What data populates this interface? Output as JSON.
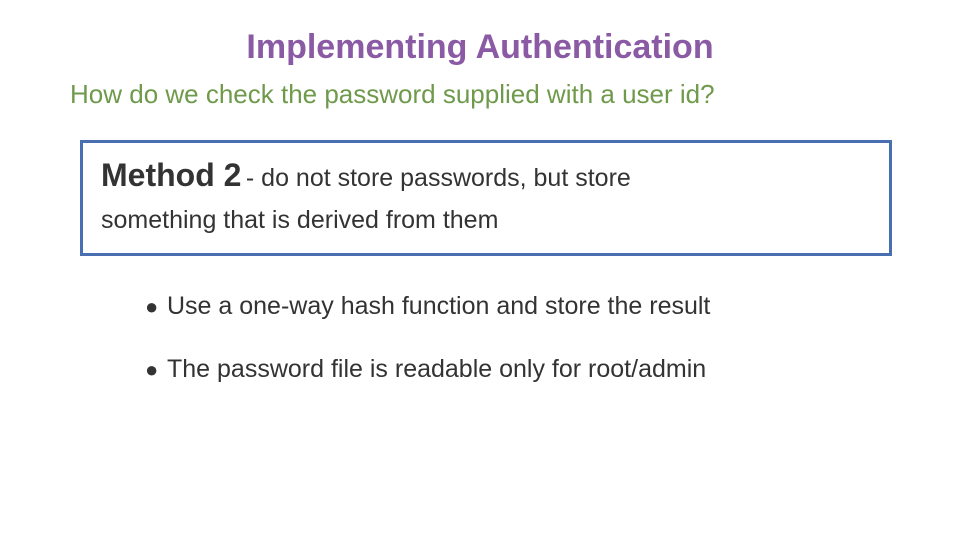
{
  "title": "Implementing Authentication",
  "subtitle": "How do we check the password supplied with a user id?",
  "method": {
    "label": "Method 2",
    "desc1": " - do not store passwords, but store",
    "desc2": "something that is derived from them"
  },
  "bullets": [
    "Use a one-way hash function and store the result",
    "The password file is readable only for root/admin"
  ]
}
